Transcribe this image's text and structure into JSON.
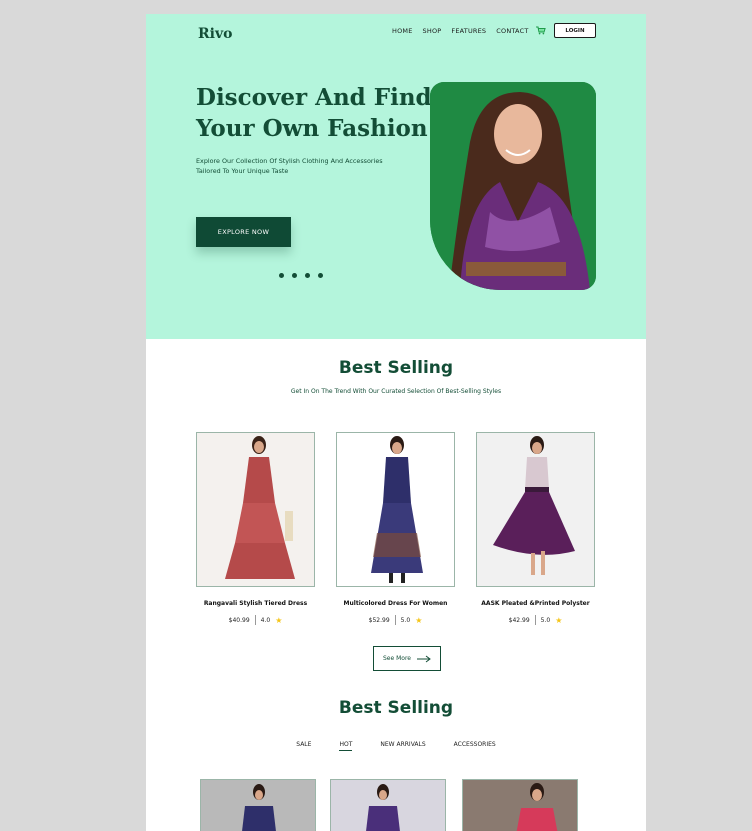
{
  "brand": {
    "logo": "Rivo"
  },
  "nav": {
    "items": [
      "HOME",
      "SHOP",
      "FEATURES",
      "CONTACT"
    ],
    "login": "LOGIN"
  },
  "hero": {
    "title_line1": "Discover And Find",
    "title_line2": "Your Own Fashion",
    "subtitle_line1": "Explore Our Collection Of Stylish Clothing And Accessories",
    "subtitle_line2": "Tailored To Your Unique Taste",
    "cta": "EXPLORE NOW",
    "slides": 4
  },
  "best_selling": {
    "title": "Best Selling",
    "subtitle": "Get In On The Trend With Our Curated Selection Of Best-Selling Styles",
    "products": [
      {
        "name": "Rangavali Stylish Tiered Dress",
        "price": "$40.99",
        "rating": "4.0"
      },
      {
        "name": "Multicolored Dress For Women",
        "price": "$52.99",
        "rating": "5.0"
      },
      {
        "name": "AASK Pleated &Printed Polyster",
        "price": "$42.99",
        "rating": "5.0"
      }
    ],
    "see_more": "See More"
  },
  "best_selling_2": {
    "title": "Best Selling",
    "tabs": [
      "SALE",
      "HOT",
      "NEW ARRIVALS",
      "ACCESSORIES"
    ],
    "active_tab": "HOT"
  },
  "colors": {
    "accent": "#134d36",
    "hero_bg": "#b4f5dc",
    "button": "#0f4a35"
  },
  "icons": [
    "cart-icon",
    "star-icon",
    "arrow-right-icon"
  ]
}
